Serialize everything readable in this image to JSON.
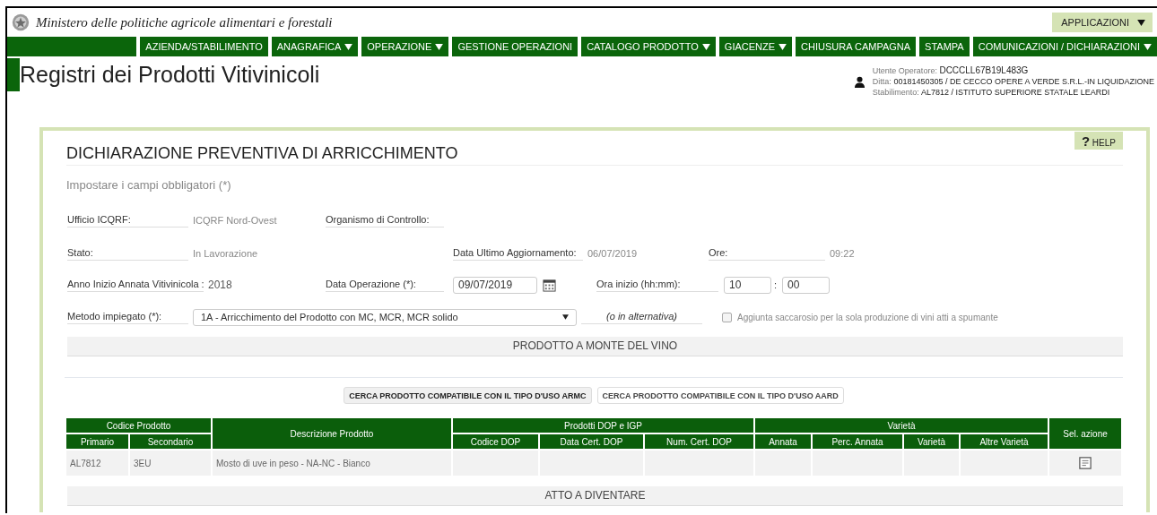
{
  "header": {
    "ministry": "Ministero delle politiche agricole alimentari e forestali",
    "apps": {
      "label": "APPLICAZIONI",
      "dropdown": true
    }
  },
  "nav": [
    {
      "label": "AZIENDA/STABILIMENTO",
      "dropdown": false
    },
    {
      "label": "ANAGRAFICA",
      "dropdown": true
    },
    {
      "label": "OPERAZIONE",
      "dropdown": true
    },
    {
      "label": "GESTIONE OPERAZIONI",
      "dropdown": false
    },
    {
      "label": "CATALOGO PRODOTTO",
      "dropdown": true
    },
    {
      "label": "GIACENZE",
      "dropdown": true
    },
    {
      "label": "CHIUSURA CAMPAGNA",
      "dropdown": false
    },
    {
      "label": "STAMPA",
      "dropdown": false
    },
    {
      "label": "COMUNICAZIONI / DICHIARAZIONI",
      "dropdown": true
    }
  ],
  "app_title": "Registri dei Prodotti Vitivinicoli",
  "user": {
    "operator_label": "Utente Operatore:",
    "operator": "DCCCLL67B19L483G",
    "ditta_label": "Ditta:",
    "ditta": "00181450305 / DE CECCO OPERE A VERDE S.R.L.-IN LIQUIDAZIONE",
    "stab_label": "Stabilimento:",
    "stab": "AL7812 / ISTITUTO SUPERIORE STATALE LEARDI"
  },
  "help": {
    "icon": "?",
    "label": "HELP"
  },
  "form": {
    "title": "DICHIARAZIONE PREVENTIVA DI ARRICCHIMENTO",
    "hint": "Impostare i campi obbligatori (*)",
    "ufficio": {
      "label": "Ufficio ICQRF:",
      "value": "ICQRF Nord-Ovest"
    },
    "organismo": {
      "label": "Organismo di Controllo:"
    },
    "stato": {
      "label": "Stato:",
      "value": "In Lavorazione"
    },
    "ultimo_aggiornamento": {
      "label": "Data Ultimo Aggiornamento:",
      "value": "06/07/2019"
    },
    "ore": {
      "label": "Ore:",
      "value": "09:22"
    },
    "anno": {
      "label": "Anno Inizio Annata Vitivinicola :",
      "value": "2018"
    },
    "data_operazione": {
      "label": "Data Operazione (*):",
      "value": "09/07/2019"
    },
    "ora_inizio": {
      "label": "Ora inizio (hh:mm):",
      "hours": "10",
      "separator": ":",
      "minutes": "00"
    },
    "metodo": {
      "label": "Metodo impiegato (*):",
      "value": "1A - Arricchimento del Prodotto con MC, MCR, MCR solido"
    },
    "alternativa": "(o in alternativa)",
    "saccarosio": {
      "label": "Aggiunta saccarosio per la sola produzione di vini atti a spumante",
      "checked": false
    }
  },
  "section_prodotto": "PRODOTTO A MONTE DEL VINO",
  "search_buttons": [
    "CERCA PRODOTTO COMPATIBILE CON IL TIPO D'USO ARMC",
    "CERCA PRODOTTO COMPATIBILE CON IL TIPO D'USO AARD"
  ],
  "table": {
    "groups": [
      {
        "label": "Codice Prodotto",
        "columns": [
          "Primario",
          "Secondario"
        ]
      },
      {
        "label": "Descrizione Prodotto"
      },
      {
        "label": "Prodotti DOP e IGP",
        "columns": [
          "Codice DOP",
          "Data Cert. DOP",
          "Num. Cert. DOP"
        ]
      },
      {
        "label": "Varietà",
        "columns": [
          "Annata",
          "Perc. Annata",
          "Varietà",
          "Altre Varietà"
        ]
      },
      {
        "label": "Sel. azione"
      }
    ],
    "rows": [
      {
        "values": [
          "AL7812",
          "3EU",
          "Mosto di uve in peso - NA-NC - Bianco"
        ]
      }
    ]
  },
  "section_atto": "ATTO A DIVENTARE"
}
